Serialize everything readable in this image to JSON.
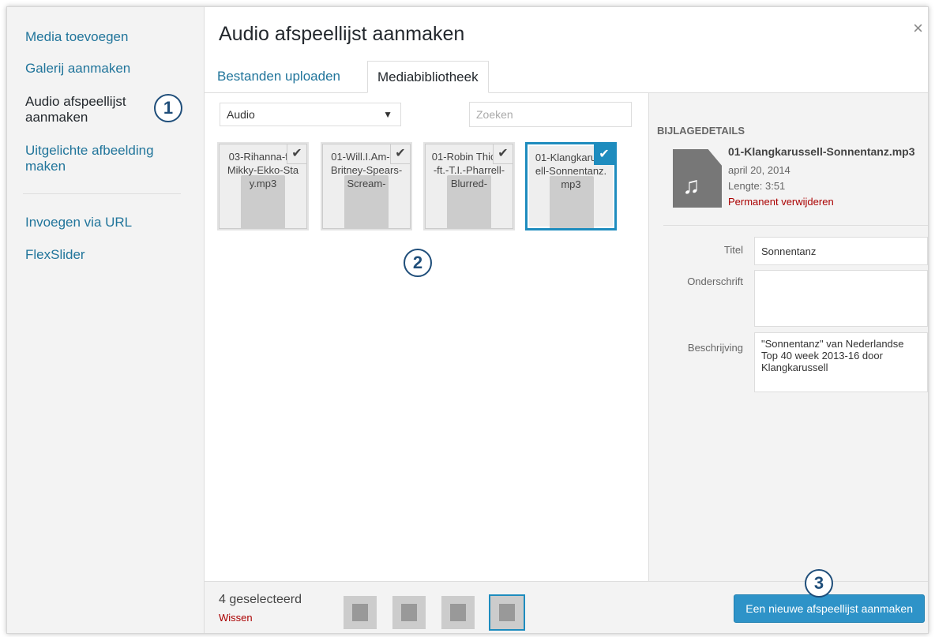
{
  "menu": {
    "items": [
      {
        "label": "Media toevoegen"
      },
      {
        "label": "Galerij aanmaken"
      },
      {
        "label": "Audio afspeellijst aanmaken"
      },
      {
        "label": "Uitgelichte afbeelding maken"
      },
      {
        "label": "Invoegen via URL"
      },
      {
        "label": "FlexSlider"
      }
    ]
  },
  "badges": [
    "1",
    "2",
    "3"
  ],
  "header": {
    "title": "Audio afspeellijst aanmaken",
    "close": "×",
    "tabs": [
      {
        "label": "Bestanden uploaden"
      },
      {
        "label": "Mediabibliotheek"
      }
    ]
  },
  "toolbar": {
    "filter_value": "Audio",
    "search_placeholder": "Zoeken"
  },
  "attachments": [
    {
      "name": "03-Rihanna-ft.-Mikky-Ekko-Stay.mp3",
      "selected": false
    },
    {
      "name": "01-Will.I.Am-ft.-Britney-Spears-Scream-",
      "selected": false
    },
    {
      "name": "01-Robin Thicke-ft.-T.I.-Pharrell-Blurred-",
      "selected": false
    },
    {
      "name": "01-Klangkarussell-Sonnentanz.mp3",
      "selected": true
    }
  ],
  "details": {
    "heading": "BIJLAGEDETAILS",
    "filename": "01-Klangkarussell-Sonnentanz.mp3",
    "date": "april 20, 2014",
    "length": "Lengte: 3:51",
    "delete": "Permanent verwijderen",
    "title_label": "Titel",
    "title_value": "Sonnentanz",
    "caption_label": "Onderschrift",
    "caption_value": "",
    "description_label": "Beschrijving",
    "description_value": "\"Sonnentanz\" van Nederlandse Top 40 week 2013-16 door Klangkarussell"
  },
  "footer": {
    "count": "4 geselecteerd",
    "clear": "Wissen",
    "primary": "Een nieuwe afspeellijst aanmaken"
  }
}
